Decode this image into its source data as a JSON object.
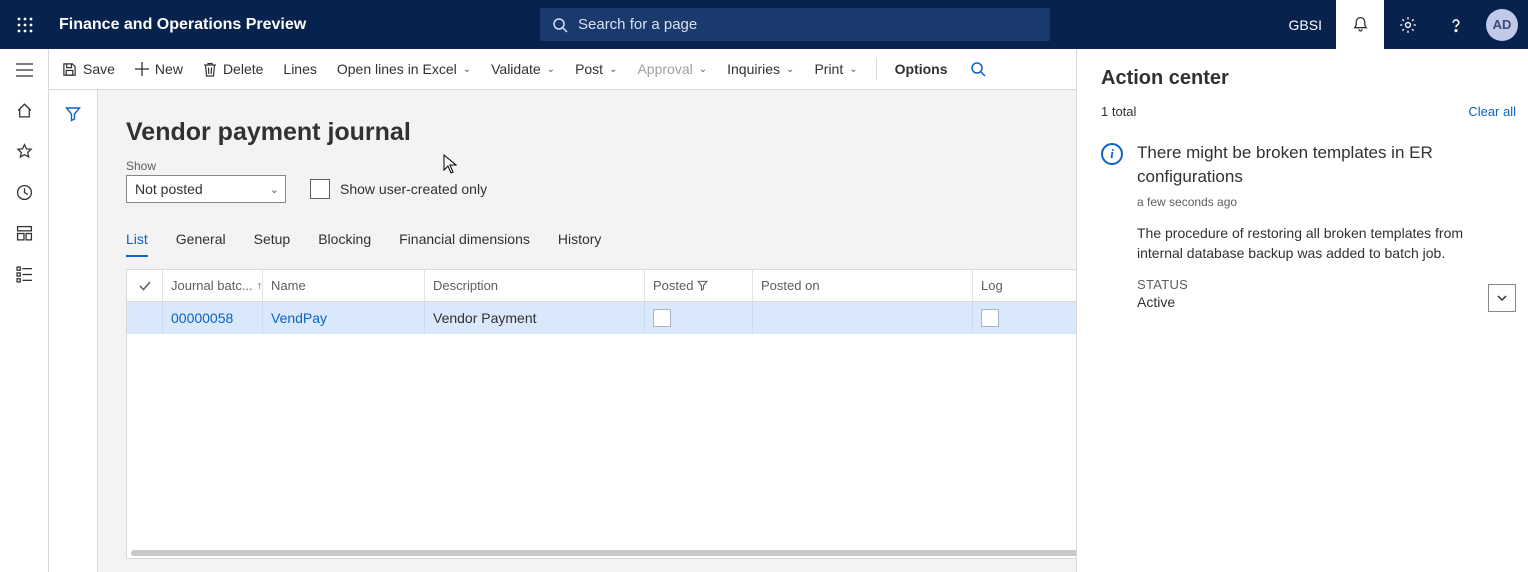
{
  "header": {
    "app_title": "Finance and Operations Preview",
    "search_placeholder": "Search for a page",
    "entity": "GBSI",
    "avatar_initials": "AD"
  },
  "actions": {
    "save": "Save",
    "new": "New",
    "delete": "Delete",
    "lines": "Lines",
    "open_excel": "Open lines in Excel",
    "validate": "Validate",
    "post": "Post",
    "approval": "Approval",
    "inquiries": "Inquiries",
    "print": "Print",
    "options": "Options"
  },
  "page": {
    "title": "Vendor payment journal",
    "show_label": "Show",
    "show_value": "Not posted",
    "show_user_created": "Show user-created only"
  },
  "tabs": {
    "list": "List",
    "general": "General",
    "setup": "Setup",
    "blocking": "Blocking",
    "financial": "Financial dimensions",
    "history": "History"
  },
  "grid": {
    "columns": {
      "batch": "Journal batc...",
      "name": "Name",
      "description": "Description",
      "posted": "Posted",
      "posted_on": "Posted on",
      "log": "Log"
    },
    "rows": [
      {
        "batch": "00000058",
        "name": "VendPay",
        "description": "Vendor Payment",
        "posted": false,
        "posted_on": "",
        "log": false
      }
    ]
  },
  "action_center": {
    "title": "Action center",
    "total": "1 total",
    "clear_all": "Clear all",
    "notification": {
      "title": "There might be broken templates in ER configurations",
      "time": "a few seconds ago",
      "text": "The procedure of restoring all broken templates from internal database backup was added to batch job.",
      "status_label": "STATUS",
      "status_value": "Active"
    }
  }
}
